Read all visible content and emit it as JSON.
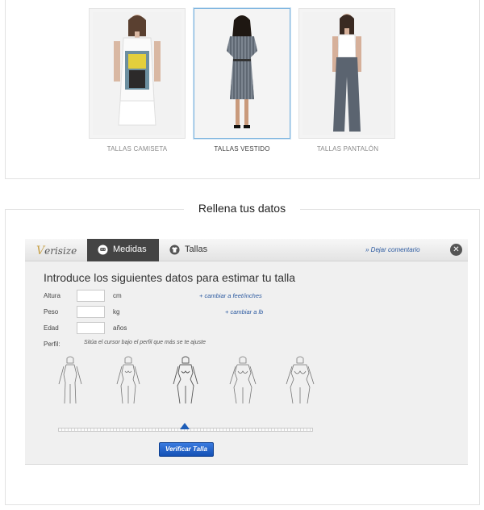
{
  "garments": [
    {
      "label": "TALLAS CAMISETA",
      "selected": false
    },
    {
      "label": "TALLAS VESTIDO",
      "selected": true
    },
    {
      "label": "TALLAS PANTALÓN",
      "selected": false
    }
  ],
  "section_title": "Rellena tus datos",
  "widget": {
    "logo_v": "V",
    "logo_rest": "erisize",
    "tabs": {
      "medidas": "Medidas",
      "tallas": "Tallas"
    },
    "comment_link": "» Dejar comentario",
    "close": "✕",
    "form_title": "Introduce los siguientes datos para estimar tu talla",
    "fields": {
      "altura": {
        "label": "Altura",
        "unit": "cm",
        "value": ""
      },
      "peso": {
        "label": "Peso",
        "unit": "kg",
        "value": ""
      },
      "edad": {
        "label": "Edad",
        "unit": "años",
        "value": ""
      }
    },
    "change_height": "+ cambiar a feet/inches",
    "change_weight": "+ cambiar a lb",
    "perfil_label": "Perfil:",
    "perfil_hint": "Sitúa el cursor bajo el perfil que más se te ajuste",
    "slider_position": 0.5,
    "verify_button": "Verificar Talla"
  },
  "colors": {
    "accent_blue": "#1d5db8",
    "tab_active": "#444444",
    "link": "#2c5aa0"
  }
}
